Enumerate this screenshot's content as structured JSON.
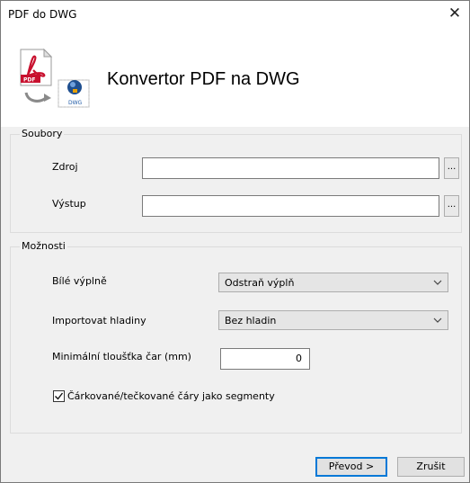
{
  "window": {
    "title": "PDF do DWG"
  },
  "header": {
    "heading": "Konvertor PDF na DWG"
  },
  "files_group": {
    "legend": "Soubory",
    "source_label": "Zdroj",
    "source_value": "",
    "output_label": "Výstup",
    "output_value": "",
    "browse_label": "..."
  },
  "options_group": {
    "legend": "Možnosti",
    "white_fills_label": "Bílé výplně",
    "white_fills_value": "Odstraň výplň",
    "import_layers_label": "Importovat hladiny",
    "import_layers_value": "Bez hladin",
    "min_thickness_label": "Minimální tloušťka čar (mm)",
    "min_thickness_value": "0",
    "dashed_label": "Čárkované/tečkované čáry jako segmenty",
    "dashed_checked": true
  },
  "buttons": {
    "convert": "Převod >",
    "cancel": "Zrušit"
  },
  "colors": {
    "accent": "#0078d7",
    "pdf_red": "#c8102e"
  }
}
